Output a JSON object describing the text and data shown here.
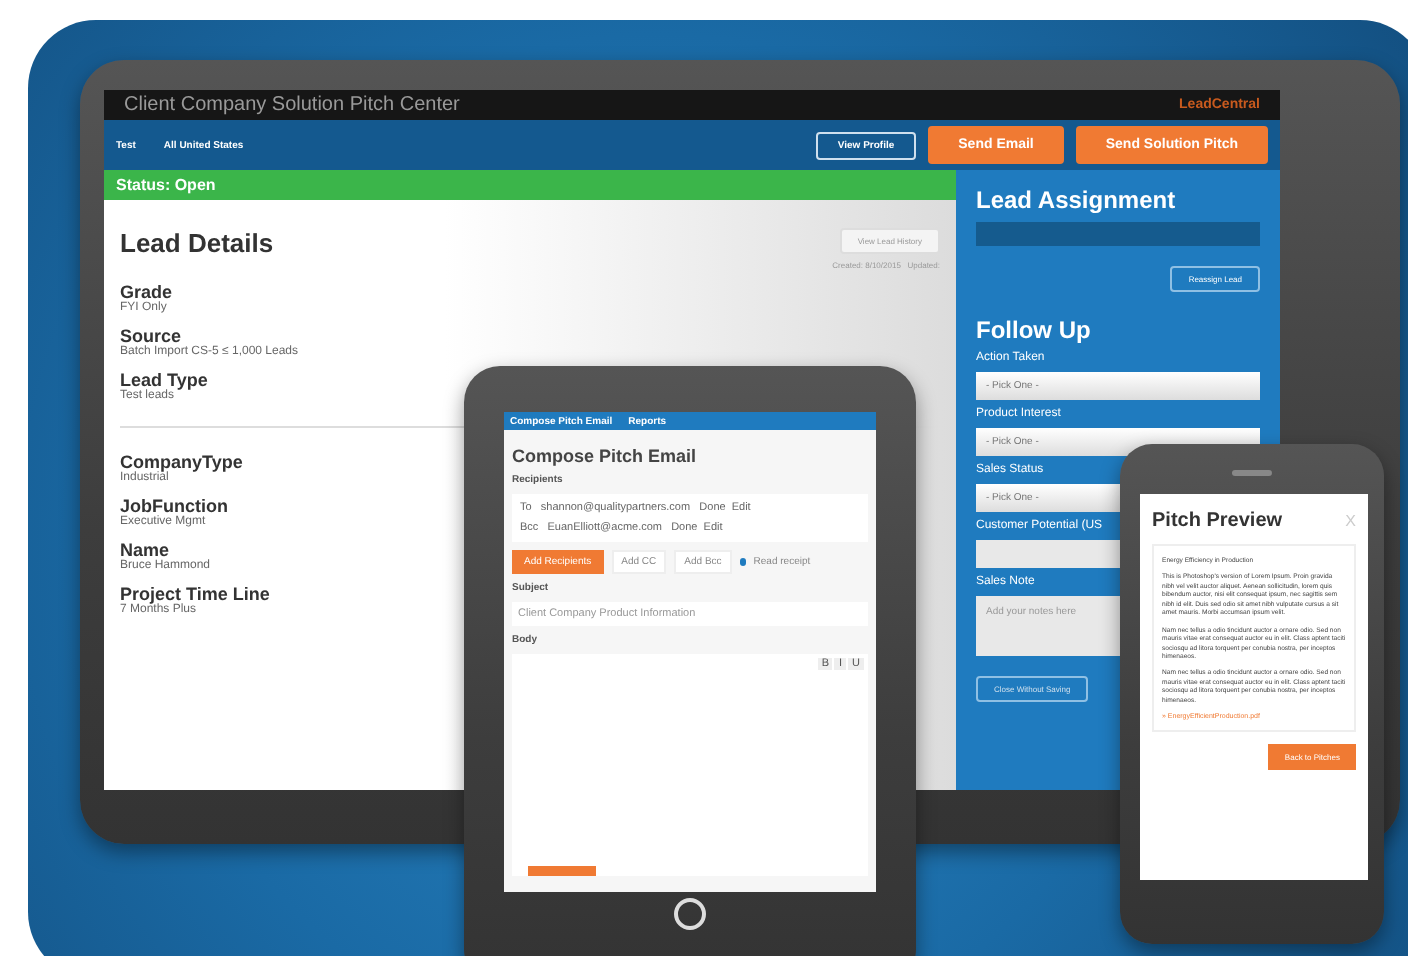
{
  "monitor": {
    "title": "Client Company Solution Pitch Center",
    "logo": "LeadCentral",
    "nav": [
      {
        "label": "Test"
      },
      {
        "label": "All United States"
      }
    ],
    "buttons": [
      {
        "label": "View Profile",
        "kind": "outline"
      },
      {
        "label": "Send Email",
        "kind": "primary"
      },
      {
        "label": "Send Solution Pitch",
        "kind": "primary"
      }
    ],
    "status": "Status: Open",
    "lead_details": {
      "heading": "Lead Details",
      "history_button": "View Lead History",
      "meta": "Created: 8/10/2015   Updated:",
      "fields": [
        {
          "label": "Grade",
          "value": "FYI Only"
        },
        {
          "label": "Source",
          "value": "Batch Import CS-5 ≤ 1,000 Leads"
        },
        {
          "label": "Lead Type",
          "value": "Test leads"
        }
      ],
      "fields_2": [
        {
          "label": "CompanyType",
          "value": "Industrial"
        },
        {
          "label": "JobFunction",
          "value": "Executive Mgmt"
        },
        {
          "label": "Name",
          "value": "Bruce Hammond"
        },
        {
          "label": "Project Time Line",
          "value": "7 Months Plus"
        }
      ]
    },
    "lead_assignment": {
      "heading": "Lead Assignment",
      "button": "Reassign Lead"
    },
    "follow_up": {
      "heading": "Follow Up",
      "fields": [
        {
          "label": "Action Taken",
          "kind": "select",
          "value": "- Pick One -"
        },
        {
          "label": "Product Interest",
          "kind": "select",
          "value": "- Pick One -"
        },
        {
          "label": "Sales Status",
          "kind": "select",
          "value": "- Pick One -"
        },
        {
          "label": "Customer Potential (US",
          "kind": "input"
        },
        {
          "label": "Sales Note",
          "kind": "textarea",
          "placeholder": "Add your notes here"
        }
      ],
      "button": "Close Without Saving"
    }
  },
  "tablet": {
    "nav": [
      {
        "label": "Compose Pitch Email"
      },
      {
        "label": "Reports"
      }
    ],
    "heading": "Compose Pitch Email",
    "recipients_label": "Recipients",
    "recipients": [
      {
        "field": "To",
        "address": "shannon@qualitypartners.com",
        "actions": "Done  Edit"
      },
      {
        "field": "Bcc",
        "address": "EuanElliott@acme.com",
        "actions": "Done  Edit"
      }
    ],
    "add_button": "Add Recipients",
    "chips": [
      "Add CC",
      "Add Bcc"
    ],
    "receipt": "Read receipt",
    "subject_label": "Subject",
    "subject_value": "Client Company Product Information",
    "body_label": "Body",
    "toolbar": [
      "B",
      "I",
      "U"
    ]
  },
  "phone": {
    "title": "Pitch Preview",
    "close": "X",
    "subject": "Energy Efficiency in Production",
    "paragraphs": [
      "This is Photoshop's version of Lorem Ipsum. Proin gravida nibh vel velit auctor aliquet. Aenean sollicitudin, lorem quis bibendum auctor, nisi elit consequat ipsum, nec sagittis sem nibh id elit. Duis sed odio sit amet nibh vulputate cursus a sit amet mauris. Morbi accumsan ipsum velit.",
      "Nam nec tellus a odio tincidunt auctor a ornare odio. Sed non mauris vitae erat consequat auctor eu in elit. Class aptent taciti sociosqu ad litora torquent per conubia nostra, per inceptos himenaeos.",
      "Nam nec tellus a odio tincidunt auctor a ornare odio. Sed non mauris vitae erat consequat auctor eu in elit. Class aptent taciti sociosqu ad litora torquent per conubia nostra, per inceptos himenaeos."
    ],
    "attachment": "» EnergyEfficientProduction.pdf",
    "button": "Back to Pitches"
  }
}
